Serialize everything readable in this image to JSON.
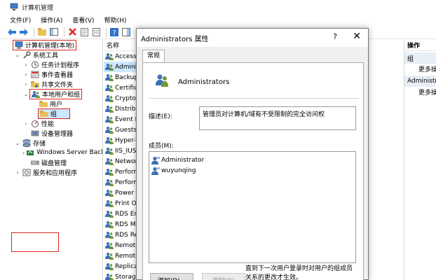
{
  "window": {
    "title": "计算机管理"
  },
  "menu": [
    "文件(F)",
    "操作(A)",
    "查看(V)",
    "帮助(H)"
  ],
  "tree": {
    "items": [
      {
        "label": "计算机管理(本地)",
        "level": 0,
        "exp": "",
        "icon": "computer-icon",
        "highlight": true
      },
      {
        "label": "系统工具",
        "level": 1,
        "exp": "⌄",
        "icon": "tools-icon"
      },
      {
        "label": "任务计划程序",
        "level": 2,
        "exp": "›",
        "icon": "clock-icon"
      },
      {
        "label": "事件查看器",
        "level": 2,
        "exp": "›",
        "icon": "event-viewer-icon"
      },
      {
        "label": "共享文件夹",
        "level": 2,
        "exp": "›",
        "icon": "shared-folder-icon"
      },
      {
        "label": "本地用户和组",
        "level": 2,
        "exp": "⌄",
        "icon": "users-icon",
        "highlight": true
      },
      {
        "label": "用户",
        "level": 3,
        "exp": "",
        "icon": "folder-icon"
      },
      {
        "label": "组",
        "level": 3,
        "exp": "",
        "icon": "folder-icon",
        "highlight": true,
        "selected": true
      },
      {
        "label": "性能",
        "level": 2,
        "exp": "›",
        "icon": "performance-icon"
      },
      {
        "label": "设备管理器",
        "level": 2,
        "exp": "",
        "icon": "device-manager-icon"
      },
      {
        "label": "存储",
        "level": 1,
        "exp": "⌄",
        "icon": "storage-icon"
      },
      {
        "label": "Windows Server Back",
        "level": 2,
        "exp": "›",
        "icon": "backup-icon"
      },
      {
        "label": "磁盘管理",
        "level": 2,
        "exp": "",
        "icon": "disk-icon"
      },
      {
        "label": "服务和应用程序",
        "level": 1,
        "exp": "›",
        "icon": "services-icon"
      }
    ]
  },
  "list": {
    "header": "名称",
    "rows": [
      "Access",
      "Adminis",
      "Backup",
      "Certifica",
      "Cryptog",
      "Distribu",
      "Event Lo",
      "Guests",
      "Hyper-V",
      "IIS_IUSR",
      "Networ",
      "Perform",
      "Perform",
      "Power U",
      "Print Op",
      "RDS En",
      "RDS Ma",
      "RDS Re",
      "Remote",
      "Remote",
      "Replicat",
      "Storage"
    ]
  },
  "actions": {
    "title": "操作",
    "sections": [
      {
        "name": "组",
        "item": "更多操作"
      },
      {
        "name": "Administra",
        "item": "更多操作"
      }
    ]
  },
  "dialog": {
    "title": "Administrators 属性",
    "help": "?",
    "close": "✕",
    "tab": "常规",
    "group_name": "Administrators",
    "description_label": "描述(E):",
    "description": "管理员对计算机/域有不受限制的完全访问权",
    "members_label": "成员(M):",
    "members": [
      "Administrator",
      "wuyunqing"
    ],
    "add_button": "添加(D)...",
    "remove_button": "删除(R)",
    "note": "直到下一次用户登录时对用户的组成员关系的更改才生效。"
  },
  "colors": {
    "highlight": "#d9261c",
    "selection": "#cce8ff",
    "folder": "#e8c25a"
  }
}
